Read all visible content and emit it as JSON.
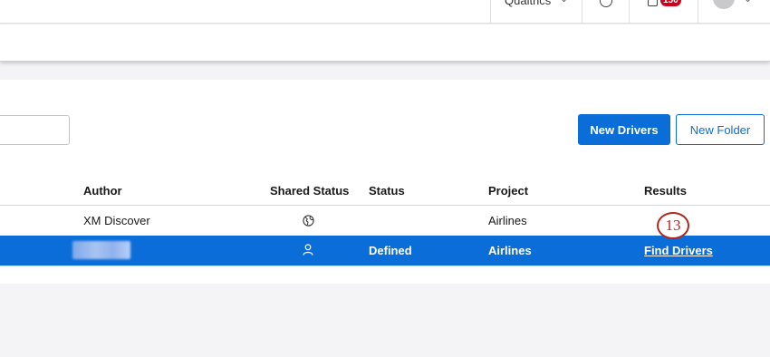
{
  "topbar": {
    "org_label": "Qualtrics",
    "notification_count": "150"
  },
  "toolbar": {
    "search_value": "",
    "new_drivers_label": "New Drivers",
    "new_folder_label": "New Folder"
  },
  "table": {
    "columns": [
      "Author",
      "Shared Status",
      "Status",
      "Project",
      "Results"
    ],
    "rows": [
      {
        "author": "XM Discover",
        "shared_icon": "globe-icon",
        "status": "",
        "project": "Airlines",
        "results": ""
      },
      {
        "author": "",
        "shared_icon": "person-icon",
        "status": "Defined",
        "project": "Airlines",
        "results": "Find Drivers",
        "selected": true
      }
    ]
  },
  "annotation": {
    "step_number": "13"
  },
  "colors": {
    "primary": "#0b6ed8",
    "badge": "#d0021b",
    "marker": "#b3261e"
  }
}
